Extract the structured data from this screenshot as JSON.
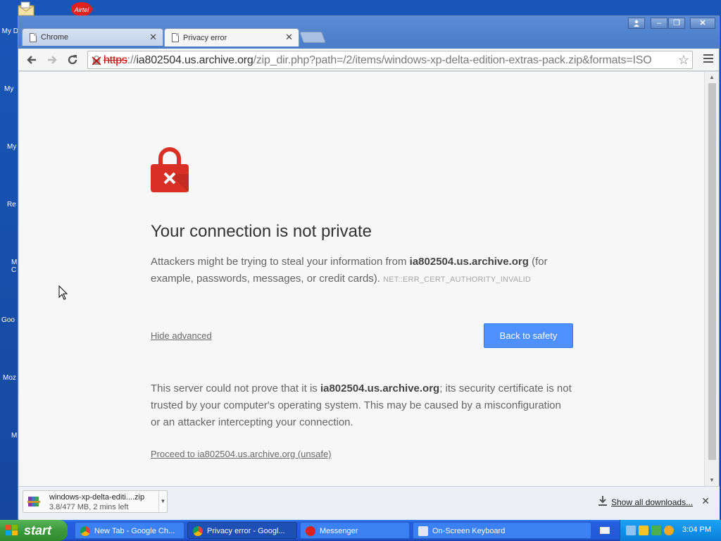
{
  "desktop": {
    "labels": [
      "My D",
      "My",
      "My",
      "Re",
      "M C",
      "Goo",
      "Moz",
      "M"
    ]
  },
  "browser": {
    "tabs": [
      {
        "label": "Chrome",
        "active": false
      },
      {
        "label": "Privacy error",
        "active": true
      }
    ],
    "window_buttons": [
      "user",
      "minimize",
      "restore",
      "close"
    ],
    "toolbar": {
      "back": "back-arrow",
      "forward": "forward-arrow",
      "reload": "reload",
      "url_scheme": "https",
      "url_sep": "://",
      "url_host": "ia802504.us.archive.org",
      "url_rest": "/zip_dir.php?path=/2/items/windows-xp-delta-edition-extras-pack.zip&formats=ISO"
    }
  },
  "page": {
    "heading": "Your connection is not private",
    "p1_before": "Attackers might be trying to steal your information from ",
    "p1_host": "ia802504.us.archive.org",
    "p1_after": " (for example, passwords, messages, or credit cards). ",
    "error_code": "NET::ERR_CERT_AUTHORITY_INVALID",
    "hide_advanced": "Hide advanced",
    "back_to_safety": "Back to safety",
    "p2_before": "This server could not prove that it is ",
    "p2_host": "ia802504.us.archive.org",
    "p2_after": "; its security certificate is not trusted by your computer's operating system. This may be caused by a misconfiguration or an attacker intercepting your connection.",
    "proceed": "Proceed to ia802504.us.archive.org (unsafe)",
    "colors": {
      "lock_red": "#d93025",
      "button_blue": "#4d90fe"
    }
  },
  "downloads": {
    "filename": "windows-xp-delta-editi....zip",
    "status": "3.8/477 MB, 2 mins left",
    "show_all": "Show all downloads..."
  },
  "taskbar": {
    "start": "start",
    "tasks": [
      {
        "label": "New Tab - Google Ch...",
        "icon": "chrome-icon"
      },
      {
        "label": "Privacy error - Googl...",
        "icon": "chrome-icon"
      },
      {
        "label": "Messenger",
        "icon": "messenger-icon"
      },
      {
        "label": "On-Screen Keyboard",
        "icon": "keyboard-icon"
      }
    ],
    "clock": "3:04 PM"
  }
}
